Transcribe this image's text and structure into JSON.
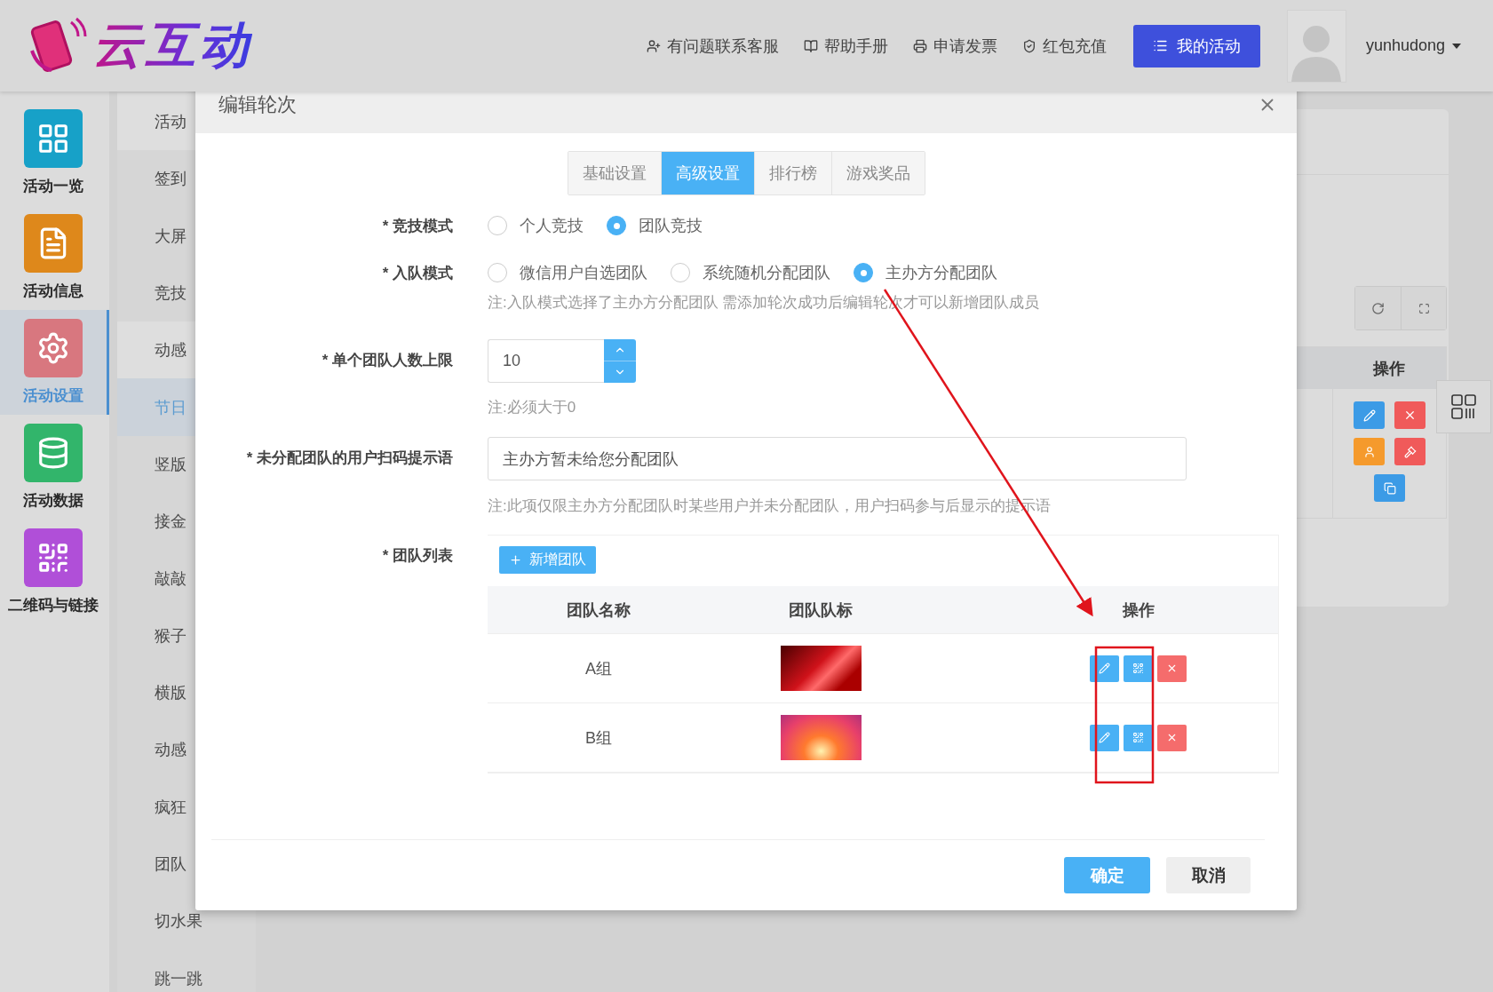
{
  "header": {
    "logo": "云互动",
    "links": [
      {
        "kind": "support",
        "label": "有问题联系客服"
      },
      {
        "kind": "manual",
        "label": "帮助手册"
      },
      {
        "kind": "invoice",
        "label": "申请发票"
      },
      {
        "kind": "recharge",
        "label": "红包充值"
      }
    ],
    "my_activities": "我的活动",
    "user": "yunhudong"
  },
  "nav": [
    {
      "kind": "overview",
      "label": "活动一览",
      "color": "#17a1c8",
      "selected": false
    },
    {
      "kind": "info",
      "label": "活动信息",
      "color": "#de881b",
      "selected": false
    },
    {
      "kind": "settings",
      "label": "活动设置",
      "color": "#d8777f",
      "selected": true
    },
    {
      "kind": "data",
      "label": "活动数据",
      "color": "#32b56b",
      "selected": false
    },
    {
      "kind": "qrcode",
      "label": "二维码与链接",
      "color": "#b04fd8",
      "selected": false
    }
  ],
  "subnav": [
    {
      "kind": "group",
      "label": "活动",
      "selected": false
    },
    {
      "kind": "item",
      "label": "签到",
      "selected": false
    },
    {
      "kind": "item",
      "label": "大屏",
      "selected": false
    },
    {
      "kind": "item",
      "label": "竞技",
      "selected": false
    },
    {
      "kind": "group",
      "label": "动感",
      "selected": false
    },
    {
      "kind": "item",
      "label": "节日",
      "selected": true
    },
    {
      "kind": "item",
      "label": "竖版",
      "selected": false
    },
    {
      "kind": "item",
      "label": "接金",
      "selected": false
    },
    {
      "kind": "item",
      "label": "敲敲",
      "selected": false
    },
    {
      "kind": "item",
      "label": "猴子",
      "selected": false
    },
    {
      "kind": "item",
      "label": "横版",
      "selected": false
    },
    {
      "kind": "item",
      "label": "动感",
      "selected": false
    },
    {
      "kind": "item",
      "label": "疯狂",
      "selected": false
    },
    {
      "kind": "item",
      "label": "团队",
      "selected": false
    },
    {
      "kind": "item",
      "label": "切水果",
      "selected": false
    },
    {
      "kind": "item",
      "label": "跳一跳",
      "selected": false
    }
  ],
  "background_table": {
    "column": "操作"
  },
  "modal": {
    "title": "编辑轮次",
    "tabs": [
      {
        "label": "基础设置",
        "selected": false
      },
      {
        "label": "高级设置",
        "selected": true
      },
      {
        "label": "排行榜",
        "selected": false
      },
      {
        "label": "游戏奖品",
        "selected": false
      }
    ],
    "fields": [
      {
        "kind": "radio",
        "label": "* 竞技模式",
        "options": [
          {
            "label": "个人竞技",
            "selected": false
          },
          {
            "label": "团队竞技",
            "selected": true
          }
        ]
      },
      {
        "kind": "radio",
        "label": "* 入队模式",
        "options": [
          {
            "label": "微信用户自选团队",
            "selected": false
          },
          {
            "label": "系统随机分配团队",
            "selected": false
          },
          {
            "label": "主办方分配团队",
            "selected": true
          }
        ],
        "note": "注:入队模式选择了主办方分配团队 需添加轮次成功后编辑轮次才可以新增团队成员"
      },
      {
        "kind": "number",
        "label": "* 单个团队人数上限",
        "value": "10",
        "note": "注:必须大于0"
      },
      {
        "kind": "text",
        "label": "* 未分配团队的用户扫码提示语",
        "value": "主办方暂未给您分配团队",
        "note": "注:此项仅限主办方分配团队时某些用户并未分配团队，用户扫码参与后显示的提示语"
      },
      {
        "kind": "teams",
        "label": "* 团队列表",
        "add_button": "新增团队",
        "columns": [
          "团队名称",
          "团队队标",
          "操作"
        ],
        "rows": [
          {
            "name": "A组"
          },
          {
            "name": "B组"
          }
        ]
      }
    ],
    "confirm": "确定",
    "cancel": "取消"
  }
}
